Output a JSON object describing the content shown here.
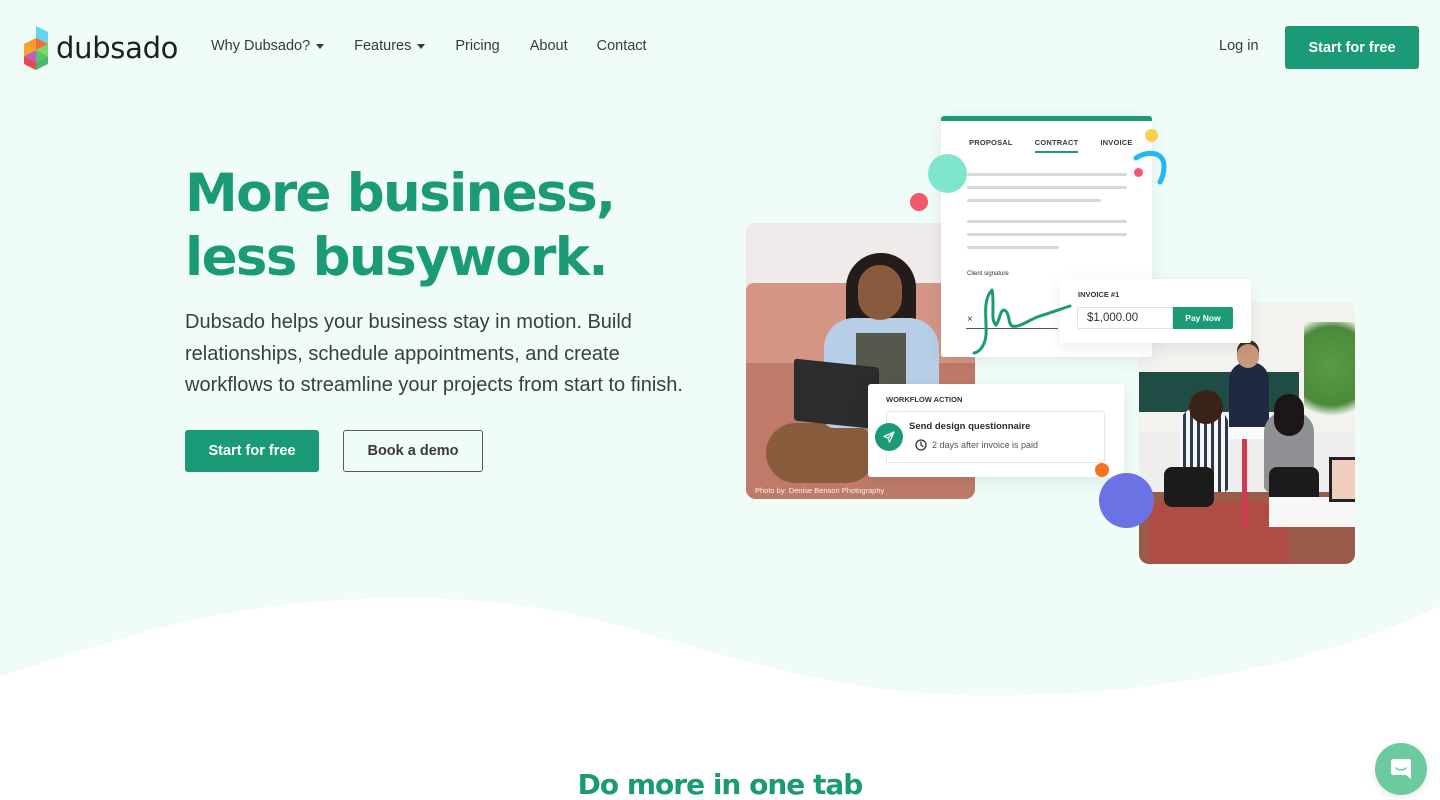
{
  "colors": {
    "brand_green": "#1a9a76",
    "hero_bg": "#effcf8",
    "chat_green": "#6ccb9e",
    "dot_mint": "#7ee6cc",
    "dot_red": "#f2576b",
    "dot_yellow": "#f7d04e",
    "dot_blue_arc": "#24b8ef",
    "dot_orange": "#f57421",
    "dot_purple": "#6b72e4"
  },
  "nav": {
    "logo_text": "dubsado",
    "links": [
      {
        "label": "Why Dubsado?",
        "has_dropdown": true
      },
      {
        "label": "Features",
        "has_dropdown": true
      },
      {
        "label": "Pricing",
        "has_dropdown": false
      },
      {
        "label": "About",
        "has_dropdown": false
      },
      {
        "label": "Contact",
        "has_dropdown": false
      }
    ],
    "login_label": "Log in",
    "cta_label": "Start for free"
  },
  "hero": {
    "headline_line1": "More business,",
    "headline_line2": "less busywork.",
    "subtext": "Dubsado helps your business stay in motion. Build relationships, schedule appointments, and create workflows to streamline your projects from start to finish.",
    "primary_cta": "Start for free",
    "secondary_cta": "Book a demo"
  },
  "illustration": {
    "doc_tabs": [
      "PROPOSAL",
      "CONTRACT",
      "INVOICE"
    ],
    "active_tab": "CONTRACT",
    "signature_label": "Client signature",
    "signature_x": "×",
    "invoice_label": "INVOICE #1",
    "invoice_amount": "$1,000.00",
    "pay_button": "Pay Now",
    "workflow_label": "WORKFLOW ACTION",
    "workflow_title": "Send design questionnaire",
    "workflow_sub": "2 days after invoice is paid",
    "photo_caption": "Photo by: Denise Benson Photography"
  },
  "section": {
    "title": "Do more in one tab"
  }
}
